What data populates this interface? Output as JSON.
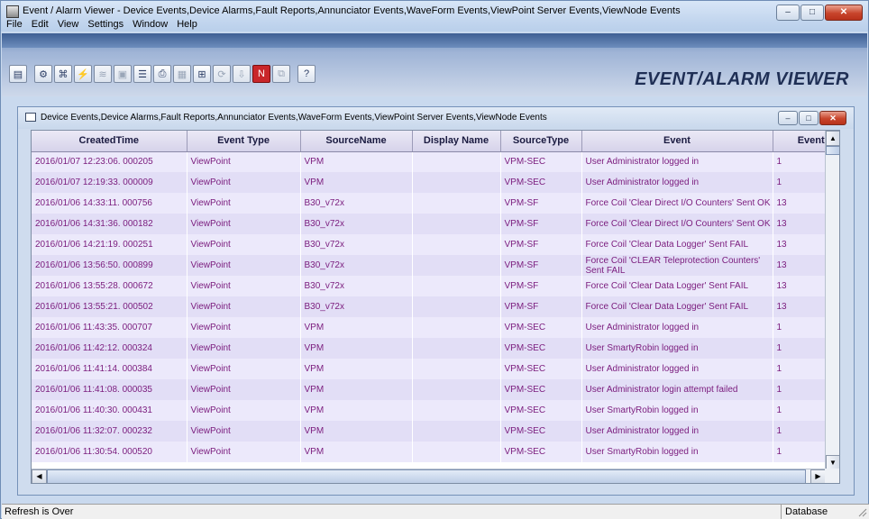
{
  "window": {
    "title": "Event / Alarm Viewer - Device Events,Device Alarms,Fault Reports,Annunciator Events,WaveForm Events,ViewPoint Server Events,ViewNode Events",
    "minimize": "–",
    "maximize": "□",
    "close": "✕"
  },
  "menu": [
    "File",
    "Edit",
    "View",
    "Settings",
    "Window",
    "Help"
  ],
  "banner": {
    "brand": "EVENT/ALARM VIEWER"
  },
  "toolbar": {
    "buttons": [
      {
        "name": "grid-view-icon",
        "glyph": "▤"
      },
      {
        "name": "event-settings-icon",
        "glyph": "⚙"
      },
      {
        "name": "device-tree-icon",
        "glyph": "⌘"
      },
      {
        "name": "connect-icon",
        "glyph": "⚡"
      },
      {
        "name": "chart-icon",
        "glyph": "≋"
      },
      {
        "name": "window-icon",
        "glyph": "▣"
      },
      {
        "name": "list-icon",
        "glyph": "☰"
      },
      {
        "name": "print-icon",
        "glyph": "⎙"
      },
      {
        "name": "calendar-icon",
        "glyph": "▦"
      },
      {
        "name": "filter-icon",
        "glyph": "⊞"
      },
      {
        "name": "refresh-icon",
        "glyph": "⟳"
      },
      {
        "name": "export-icon",
        "glyph": "⇩"
      },
      {
        "name": "alarm-icon",
        "glyph": "N"
      },
      {
        "name": "copy-icon",
        "glyph": "⧉"
      },
      {
        "name": "help-icon",
        "glyph": "?"
      }
    ]
  },
  "child_window": {
    "title": "Device Events,Device Alarms,Fault Reports,Annunciator Events,WaveForm Events,ViewPoint Server Events,ViewNode Events"
  },
  "grid": {
    "columns": [
      "CreatedTime",
      "Event Type",
      "SourceName",
      "Display Name",
      "SourceType",
      "Event",
      "EventCo"
    ],
    "rows": [
      [
        "2016/01/07 12:23:06. 000205",
        "ViewPoint",
        "VPM",
        "",
        "VPM-SEC",
        "User Administrator logged in",
        "1"
      ],
      [
        "2016/01/07 12:19:33. 000009",
        "ViewPoint",
        "VPM",
        "",
        "VPM-SEC",
        "User Administrator logged in",
        "1"
      ],
      [
        "2016/01/06 14:33:11. 000756",
        "ViewPoint",
        "B30_v72x",
        "",
        "VPM-SF",
        "Force Coil 'Clear Direct I/O Counters' Sent OK",
        "13"
      ],
      [
        "2016/01/06 14:31:36. 000182",
        "ViewPoint",
        "B30_v72x",
        "",
        "VPM-SF",
        "Force Coil 'Clear Direct I/O Counters' Sent OK",
        "13"
      ],
      [
        "2016/01/06 14:21:19. 000251",
        "ViewPoint",
        "B30_v72x",
        "",
        "VPM-SF",
        "Force Coil 'Clear Data Logger' Sent FAIL",
        "13"
      ],
      [
        "2016/01/06 13:56:50. 000899",
        "ViewPoint",
        "B30_v72x",
        "",
        "VPM-SF",
        "Force Coil 'CLEAR Teleprotection Counters' Sent FAIL",
        "13"
      ],
      [
        "2016/01/06 13:55:28. 000672",
        "ViewPoint",
        "B30_v72x",
        "",
        "VPM-SF",
        "Force Coil 'Clear Data Logger' Sent FAIL",
        "13"
      ],
      [
        "2016/01/06 13:55:21. 000502",
        "ViewPoint",
        "B30_v72x",
        "",
        "VPM-SF",
        "Force Coil 'Clear Data Logger' Sent FAIL",
        "13"
      ],
      [
        "2016/01/06 11:43:35. 000707",
        "ViewPoint",
        "VPM",
        "",
        "VPM-SEC",
        "User Administrator logged in",
        "1"
      ],
      [
        "2016/01/06 11:42:12. 000324",
        "ViewPoint",
        "VPM",
        "",
        "VPM-SEC",
        "User SmartyRobin logged in",
        "1"
      ],
      [
        "2016/01/06 11:41:14. 000384",
        "ViewPoint",
        "VPM",
        "",
        "VPM-SEC",
        "User Administrator logged in",
        "1"
      ],
      [
        "2016/01/06 11:41:08. 000035",
        "ViewPoint",
        "VPM",
        "",
        "VPM-SEC",
        "User Administrator login attempt failed",
        "1"
      ],
      [
        "2016/01/06 11:40:30. 000431",
        "ViewPoint",
        "VPM",
        "",
        "VPM-SEC",
        "User SmartyRobin logged in",
        "1"
      ],
      [
        "2016/01/06 11:32:07. 000232",
        "ViewPoint",
        "VPM",
        "",
        "VPM-SEC",
        "User Administrator logged in",
        "1"
      ],
      [
        "2016/01/06 11:30:54. 000520",
        "ViewPoint",
        "VPM",
        "",
        "VPM-SEC",
        "User SmartyRobin logged in",
        "1"
      ]
    ]
  },
  "statusbar": {
    "message": "Refresh is Over",
    "mode": "Database"
  }
}
